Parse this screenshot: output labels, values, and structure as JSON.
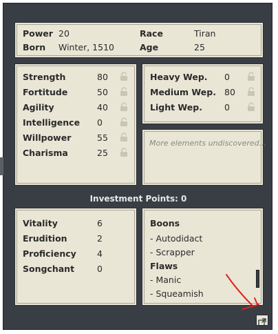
{
  "info": {
    "power_label": "Power",
    "power_value": "20",
    "race_label": "Race",
    "race_value": "Tiran",
    "born_label": "Born",
    "born_value": "Winter, 1510",
    "age_label": "Age",
    "age_value": "25"
  },
  "attributes": [
    {
      "label": "Strength",
      "value": "80"
    },
    {
      "label": "Fortitude",
      "value": "50"
    },
    {
      "label": "Agility",
      "value": "40"
    },
    {
      "label": "Intelligence",
      "value": "0"
    },
    {
      "label": "Willpower",
      "value": "55"
    },
    {
      "label": "Charisma",
      "value": "25"
    }
  ],
  "weapons": [
    {
      "label": "Heavy Wep.",
      "value": "0"
    },
    {
      "label": "Medium Wep.",
      "value": "80"
    },
    {
      "label": "Light Wep.",
      "value": "0"
    }
  ],
  "undiscovered": "More elements undiscovered...",
  "investment": "Investment Points: 0",
  "skills": [
    {
      "label": "Vitality",
      "value": "6"
    },
    {
      "label": "Erudition",
      "value": "2"
    },
    {
      "label": "Proficiency",
      "value": "4"
    },
    {
      "label": "Songchant",
      "value": "0"
    }
  ],
  "traits": {
    "boons_title": "Boons",
    "boons": [
      "- Autodidact",
      "- Scrapper"
    ],
    "flaws_title": "Flaws",
    "flaws": [
      "- Manic",
      "- Squeamish"
    ]
  },
  "icons": {
    "lock": "lock-icon",
    "export": "external-link-icon"
  },
  "colors": {
    "frame": "#393e45",
    "panel": "#e9e6d6",
    "annotation": "#e0231a"
  }
}
